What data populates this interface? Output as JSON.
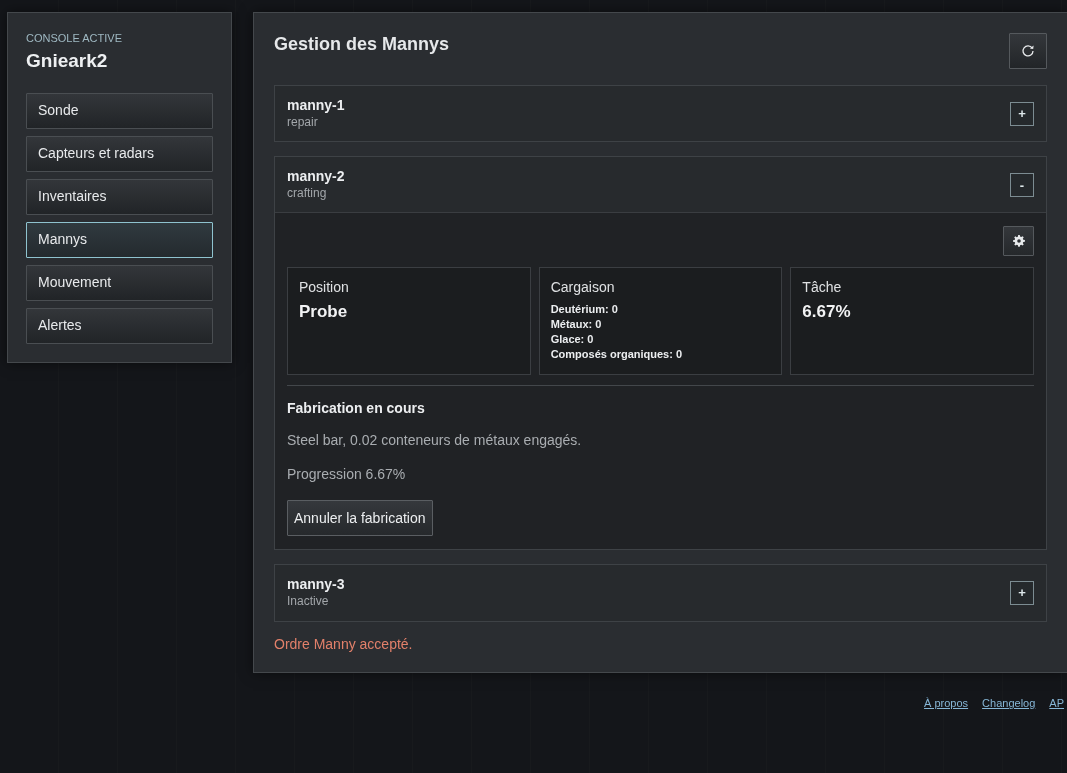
{
  "console": {
    "label": "CONSOLE ACTIVE",
    "name": "Gnieark2"
  },
  "nav": [
    {
      "label": "Sonde",
      "selected": false
    },
    {
      "label": "Capteurs et radars",
      "selected": false
    },
    {
      "label": "Inventaires",
      "selected": false
    },
    {
      "label": "Mannys",
      "selected": true
    },
    {
      "label": "Mouvement",
      "selected": false
    },
    {
      "label": "Alertes",
      "selected": false
    }
  ],
  "main": {
    "title": "Gestion des Mannys",
    "mannys": [
      {
        "name": "manny-1",
        "task": "repair",
        "toggle": "+",
        "expanded": false
      },
      {
        "name": "manny-2",
        "task": "crafting",
        "toggle": "-",
        "expanded": true,
        "details": {
          "position": {
            "label": "Position",
            "value": "Probe"
          },
          "cargo": {
            "label": "Cargaison",
            "items": [
              "Deutérium: 0",
              "Métaux: 0",
              "Glace: 0",
              "Composés organiques: 0"
            ]
          },
          "task": {
            "label": "Tâche",
            "value": "6.67%"
          },
          "crafting": {
            "title": "Fabrication en cours",
            "description": "Steel bar, 0.02 conteneurs de métaux engagés.",
            "progress": "Progression 6.67%",
            "cancel_button": "Annuler la fabrication"
          }
        }
      },
      {
        "name": "manny-3",
        "task": "Inactive",
        "toggle": "+",
        "expanded": false
      }
    ],
    "message": "Ordre Manny accepté."
  },
  "footer_links": [
    "À propos",
    "Changelog",
    "AP"
  ]
}
